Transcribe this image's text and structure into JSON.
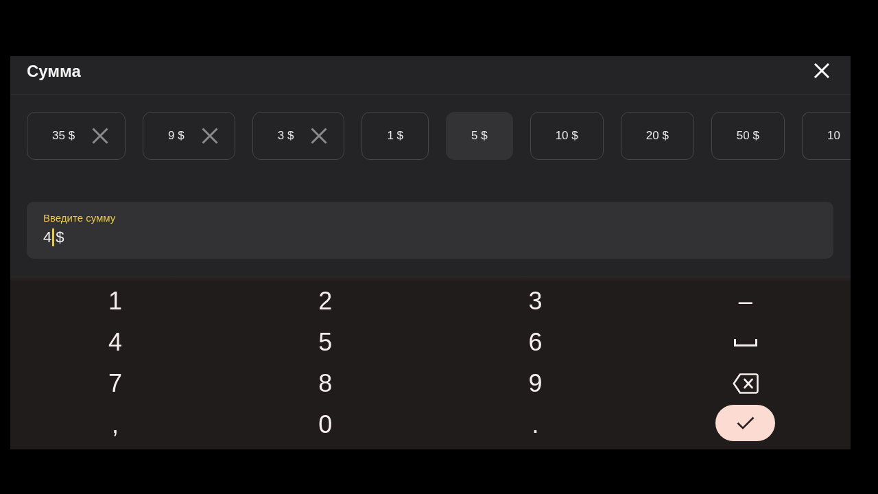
{
  "dialog": {
    "title": "Сумма"
  },
  "presets": [
    {
      "label": "35 $",
      "removable": true,
      "selected": false
    },
    {
      "label": "9 $",
      "removable": true,
      "selected": false
    },
    {
      "label": "3 $",
      "removable": true,
      "selected": false
    },
    {
      "label": "1 $",
      "removable": false,
      "selected": false
    },
    {
      "label": "5 $",
      "removable": false,
      "selected": true
    },
    {
      "label": "10 $",
      "removable": false,
      "selected": false
    },
    {
      "label": "20 $",
      "removable": false,
      "selected": false
    },
    {
      "label": "50 $",
      "removable": false,
      "selected": false
    },
    {
      "label": "10",
      "removable": false,
      "selected": false
    }
  ],
  "amount_field": {
    "label": "Введите сумму",
    "value": "4",
    "suffix": "$",
    "focused": true
  },
  "keypad": {
    "keys": [
      {
        "kind": "char",
        "label": "1"
      },
      {
        "kind": "char",
        "label": "2"
      },
      {
        "kind": "char",
        "label": "3"
      },
      {
        "kind": "char",
        "label": "–"
      },
      {
        "kind": "char",
        "label": "4"
      },
      {
        "kind": "char",
        "label": "5"
      },
      {
        "kind": "char",
        "label": "6"
      },
      {
        "kind": "space"
      },
      {
        "kind": "char",
        "label": "7"
      },
      {
        "kind": "char",
        "label": "8"
      },
      {
        "kind": "char",
        "label": "9"
      },
      {
        "kind": "backspace"
      },
      {
        "kind": "char",
        "label": ","
      },
      {
        "kind": "char",
        "label": "0"
      },
      {
        "kind": "char",
        "label": "."
      },
      {
        "kind": "done"
      }
    ]
  }
}
